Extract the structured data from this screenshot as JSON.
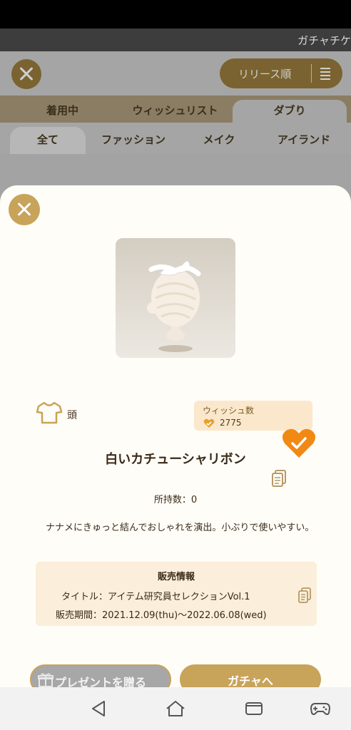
{
  "top_strip": {
    "label": "ガチャチケ"
  },
  "header": {
    "sort_label": "リリース順"
  },
  "tabs_primary": [
    {
      "label": "着用中"
    },
    {
      "label": "ウィッシュリスト"
    },
    {
      "label": "ダブり",
      "active": true
    }
  ],
  "tabs_secondary": [
    {
      "label": "全て",
      "active": true
    },
    {
      "label": "ファッション"
    },
    {
      "label": "メイク"
    },
    {
      "label": "アイランド"
    }
  ],
  "item": {
    "category": "頭",
    "wish_label": "ウィッシュ数",
    "wish_count": "2775",
    "name": "白いカチューシャリボン",
    "owned": "所持数：0",
    "description": "ナナメにきゅっと結んでおしゃれを演出。小ぶりで使いやすい。"
  },
  "sales": {
    "heading": "販売情報",
    "title": "タイトル：アイテム研究員セレクションVol.1",
    "period": "販売期間：2021.12.09(thu)〜2022.06.08(wed)"
  },
  "buttons": {
    "present": "プレゼントを贈る",
    "gacha": "ガチャへ"
  },
  "colors": {
    "accent": "#c8a35a",
    "wish_heart": "#f08a14",
    "sheet_bg": "#fffdf8",
    "info_box_bg": "#fbeedb"
  },
  "icons": [
    "close-icon",
    "sort-icon",
    "shirt-icon",
    "heart-icon",
    "copy-icon",
    "gift-icon",
    "back-icon",
    "home-icon",
    "recents-icon",
    "gamepad-icon"
  ]
}
